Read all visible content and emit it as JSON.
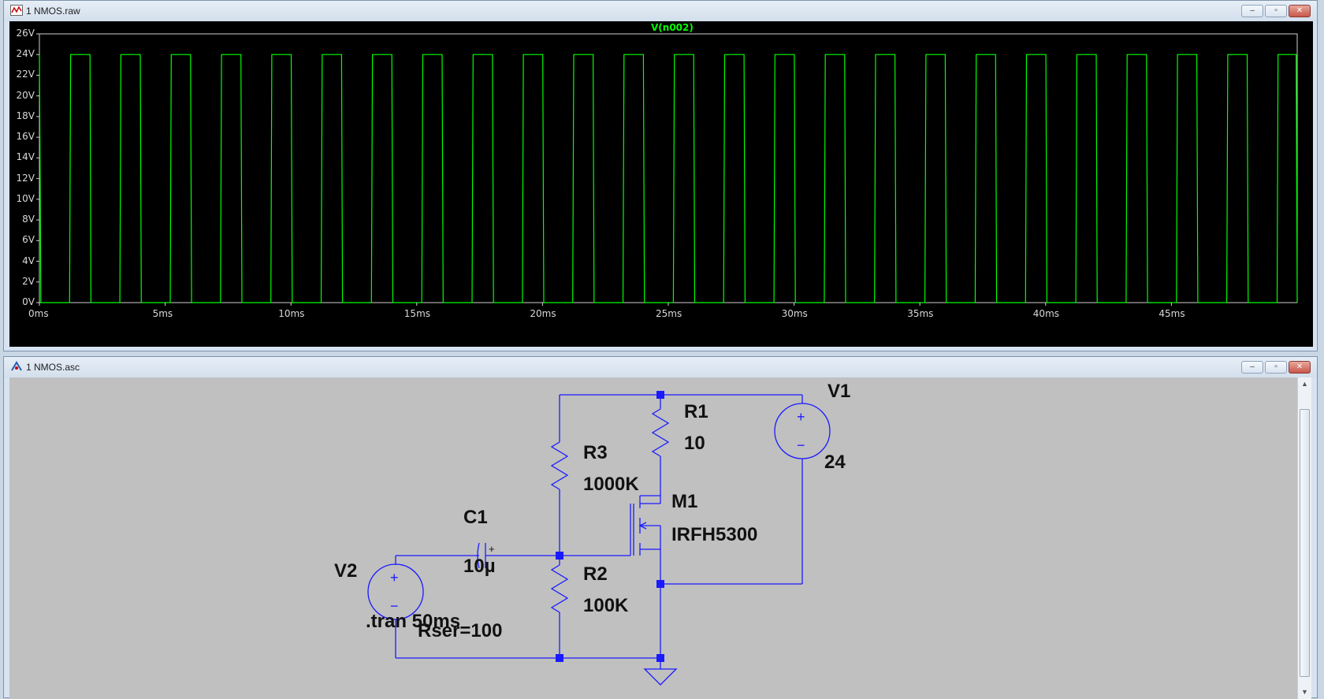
{
  "waveform_window": {
    "title": "1 NMOS.raw",
    "trace_label": "V(n002)",
    "chart_data": {
      "type": "line",
      "title": "V(n002)",
      "xlabel": "",
      "ylabel": "",
      "xlim": [
        0,
        50
      ],
      "ylim": [
        0,
        26
      ],
      "x_unit": "ms",
      "y_unit": "V",
      "grid": false,
      "x_ticks": [
        "0ms",
        "5ms",
        "10ms",
        "15ms",
        "20ms",
        "25ms",
        "30ms",
        "35ms",
        "40ms",
        "45ms"
      ],
      "y_ticks": [
        "26V",
        "24V",
        "22V",
        "20V",
        "18V",
        "16V",
        "14V",
        "12V",
        "10V",
        "8V",
        "6V",
        "4V",
        "2V",
        "0V"
      ],
      "series": [
        {
          "name": "V(n002)",
          "color": "#00ff00",
          "period_ms": 2.0,
          "high_v": 24,
          "low_v": 0,
          "pulses_ms": [
            [
              0,
              0.06
            ],
            [
              1.2,
              2.05
            ],
            [
              3.2,
              4.05
            ],
            [
              5.2,
              6.05
            ],
            [
              7.2,
              8.05
            ],
            [
              9.2,
              10.05
            ],
            [
              11.2,
              12.05
            ],
            [
              13.2,
              14.05
            ],
            [
              15.2,
              16.05
            ],
            [
              17.2,
              18.05
            ],
            [
              19.2,
              20.05
            ],
            [
              21.2,
              22.05
            ],
            [
              23.2,
              24.05
            ],
            [
              25.2,
              26.05
            ],
            [
              27.2,
              28.05
            ],
            [
              29.2,
              30.05
            ],
            [
              31.2,
              32.05
            ],
            [
              33.2,
              34.05
            ],
            [
              35.2,
              36.05
            ],
            [
              37.2,
              38.05
            ],
            [
              39.2,
              40.05
            ],
            [
              41.2,
              42.05
            ],
            [
              43.2,
              44.05
            ],
            [
              45.2,
              46.05
            ],
            [
              47.2,
              48.05
            ],
            [
              49.2,
              50
            ]
          ]
        }
      ]
    }
  },
  "schematic_window": {
    "title": "1 NMOS.asc",
    "wire_color": "#0000ff",
    "labels": {
      "v1_name": "V1",
      "v1_value": "24",
      "r1_name": "R1",
      "r1_value": "10",
      "r3_name": "R3",
      "r3_value": "1000K",
      "m1_name": "M1",
      "m1_value": "IRFH5300",
      "c1_name": "C1",
      "c1_value": "10µ",
      "v2_name": "V2",
      "r2_name": "R2",
      "r2_value": "100K",
      "tran_directive": ".tran 50ms",
      "rser": "Rser=100",
      "cap_plus": "+",
      "src_plus": "+",
      "src_minus": "−"
    }
  },
  "window_controls": {
    "minimize": "–",
    "restore": "▫",
    "close": "✕"
  },
  "scrollbar": {
    "up": "▲",
    "down": "▼"
  }
}
